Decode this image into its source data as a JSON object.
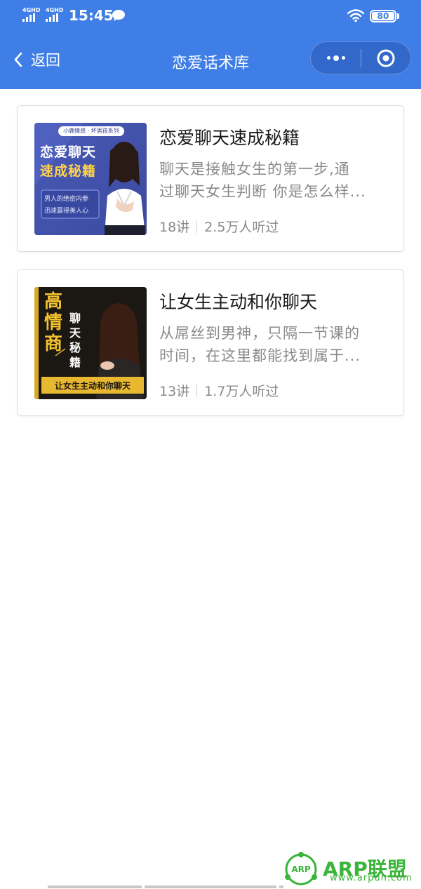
{
  "status_bar": {
    "network_1": "4GHD",
    "network_2": "4GHD",
    "time": "15:45",
    "battery": "80"
  },
  "nav": {
    "back_label": "返回",
    "title": "恋爱话术库"
  },
  "courses": [
    {
      "title": "恋爱聊天速成秘籍",
      "desc_line1": "聊天是接触女生的第一步,通",
      "desc_line2": "过聊天女生判断 你是怎么样...",
      "lessons": "18讲",
      "listeners": "2.5万人听过",
      "cover": {
        "series": "小鹿情感 · 坏男孩系列",
        "title_line1": "恋爱聊天",
        "title_line2": "速成秘籍",
        "quote_line1": "男人的绝密内参",
        "quote_line2": "迅速赢得美人心"
      }
    },
    {
      "title": "让女生主动和你聊天",
      "desc_line1": "从屌丝到男神，只隔一节课的",
      "desc_line2": "时间，在这里都能找到属于...",
      "lessons": "13讲",
      "listeners": "1.7万人听过",
      "cover": {
        "big_chars": [
          "高",
          "情",
          "商"
        ],
        "side_chars": [
          "聊",
          "天",
          "秘",
          "籍"
        ],
        "banner": "让女生主动和你聊天"
      }
    }
  ],
  "watermark": {
    "logo_text": "ARP",
    "brand": "ARP联盟",
    "url": "www.arpun.com"
  },
  "colors": {
    "header_bg": "#3f7ee6",
    "title_text": "#1a1a1a",
    "secondary_text": "#8a8a8a",
    "watermark_green": "#3ab53a"
  }
}
